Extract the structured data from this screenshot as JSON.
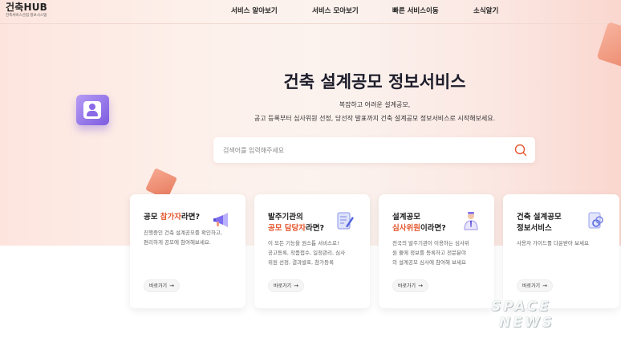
{
  "header": {
    "logo_title": "건축HUB",
    "logo_sub": "건축서비스산업 정보시스템",
    "nav": [
      "서비스 알아보기",
      "서비스 모아보기",
      "빠른 서비스이동",
      "소식알기"
    ]
  },
  "hero": {
    "title": "건축 설계공모 정보서비스",
    "desc_line1": "복잡하고 어려운 설계공모,",
    "desc_line2": "공고 등록부터 심사위원 선정, 당선작 발표까지 건축 설계공모 정보서비스로 시작해보세요."
  },
  "search": {
    "placeholder": "검색어를 입력해주세요"
  },
  "cards": [
    {
      "title_pre": "공모 ",
      "title_accent": "참가자",
      "title_post": "라면?",
      "desc": [
        "진행중인 건축 설계공모를 확인하고,",
        "편리하게 공모에 참여해보세요."
      ],
      "button": "바로가기",
      "icon": "megaphone-icon"
    },
    {
      "title_line1": "발주기관의",
      "title_accent": "공모 담당자",
      "title_post": "라면?",
      "desc": [
        "이 모든 기능을 원스톱 서비스로!",
        "공고등록, 작품접수, 일정관리, 심사",
        "위원 선정, 결과발표, 참가등록"
      ],
      "button": "바로가기",
      "icon": "document-pen-icon"
    },
    {
      "title_line1": "설계공모",
      "title_accent": "심사위원",
      "title_post": "이라면?",
      "desc": [
        "전국의 발주기관이 이용하는 심사위",
        "원 풀에 정보를 등록하고 전문분야",
        "의 설계공모 심사에 참여해 보세요"
      ],
      "button": "바로가기",
      "icon": "judge-person-icon"
    },
    {
      "title_line1": "건축 설계공모",
      "title_line2": "정보서비스",
      "desc": [
        "사용자 가이드를 다운받아 보세요"
      ],
      "button": "바로가기",
      "icon": "guide-link-icon"
    }
  ],
  "watermark": {
    "line1": "SPACE",
    "line2": "NEWS"
  },
  "colors": {
    "accent": "#e4572e",
    "profile_purple": "#8a6ae6",
    "cube_coral": "#ec8c70"
  }
}
